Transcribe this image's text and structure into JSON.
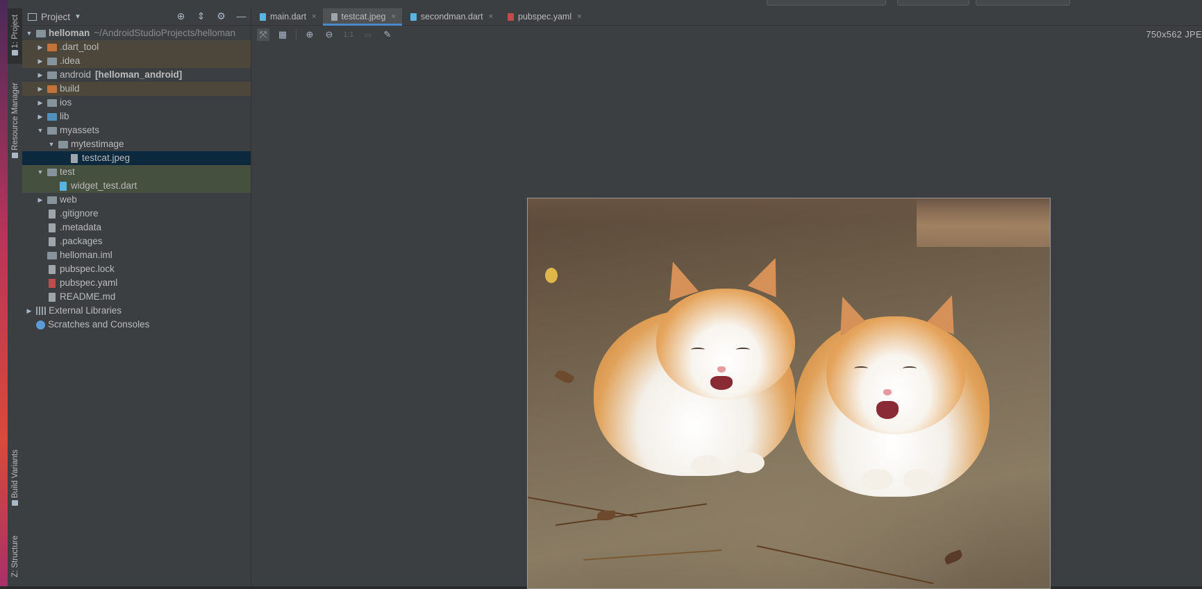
{
  "sidebar_stripe": {
    "tabs": [
      {
        "label": "1: Project",
        "active": true
      },
      {
        "label": "Resource Manager",
        "active": false
      },
      {
        "label": "Build Variants",
        "active": false
      },
      {
        "label": "Z: Structure",
        "active": false
      }
    ]
  },
  "project_panel": {
    "title": "Project",
    "tree": [
      {
        "label": "helloman",
        "extra": "~/AndroidStudioProjects/helloman",
        "bold": true,
        "depth": 0,
        "arrow": "expanded",
        "icon": "module-folder-icon"
      },
      {
        "label": ".dart_tool",
        "depth": 1,
        "arrow": "collapsed",
        "icon": "excluded-folder-icon",
        "bg": "tan"
      },
      {
        "label": ".idea",
        "depth": 1,
        "arrow": "collapsed",
        "icon": "settings-folder-icon",
        "bg": "tan"
      },
      {
        "label": "android",
        "extra": "[helloman_android]",
        "depth": 1,
        "arrow": "collapsed",
        "icon": "module-folder-icon"
      },
      {
        "label": "build",
        "depth": 1,
        "arrow": "collapsed",
        "icon": "excluded-folder-icon",
        "bg": "tan"
      },
      {
        "label": "ios",
        "depth": 1,
        "arrow": "collapsed",
        "icon": "folder-icon"
      },
      {
        "label": "lib",
        "depth": 1,
        "arrow": "collapsed",
        "icon": "source-folder-icon"
      },
      {
        "label": "myassets",
        "depth": 1,
        "arrow": "expanded",
        "icon": "folder-icon"
      },
      {
        "label": "mytestimage",
        "depth": 2,
        "arrow": "expanded",
        "icon": "folder-icon"
      },
      {
        "label": "testcat.jpeg",
        "depth": 3,
        "arrow": "none",
        "icon": "image-file-icon",
        "bg": "selected"
      },
      {
        "label": "test",
        "depth": 1,
        "arrow": "expanded",
        "icon": "test-folder-icon",
        "bg": "green"
      },
      {
        "label": "widget_test.dart",
        "depth": 2,
        "arrow": "none",
        "icon": "dart-file-icon",
        "bg": "green"
      },
      {
        "label": "web",
        "depth": 1,
        "arrow": "collapsed",
        "icon": "web-folder-icon"
      },
      {
        "label": ".gitignore",
        "depth": 1,
        "arrow": "none",
        "icon": "text-file-icon"
      },
      {
        "label": ".metadata",
        "depth": 1,
        "arrow": "none",
        "icon": "text-file-icon"
      },
      {
        "label": ".packages",
        "depth": 1,
        "arrow": "none",
        "icon": "text-file-icon"
      },
      {
        "label": "helloman.iml",
        "depth": 1,
        "arrow": "none",
        "icon": "module-file-icon"
      },
      {
        "label": "pubspec.lock",
        "depth": 1,
        "arrow": "none",
        "icon": "text-file-icon"
      },
      {
        "label": "pubspec.yaml",
        "depth": 1,
        "arrow": "none",
        "icon": "yaml-file-icon"
      },
      {
        "label": "README.md",
        "depth": 1,
        "arrow": "none",
        "icon": "text-file-icon"
      },
      {
        "label": "External Libraries",
        "depth": 0,
        "arrow": "collapsed",
        "icon": "libraries-icon"
      },
      {
        "label": "Scratches and Consoles",
        "depth": 0,
        "arrow": "none",
        "icon": "scratches-icon"
      }
    ]
  },
  "editor": {
    "tabs": [
      {
        "label": "main.dart",
        "icon": "dart-file-icon",
        "active": false
      },
      {
        "label": "testcat.jpeg",
        "icon": "image-file-icon",
        "active": true
      },
      {
        "label": "secondman.dart",
        "icon": "dart-file-icon",
        "active": false
      },
      {
        "label": "pubspec.yaml",
        "icon": "yaml-file-icon",
        "active": false
      }
    ],
    "zoom_label": "1:1",
    "image_info": "750x562 JPE"
  }
}
